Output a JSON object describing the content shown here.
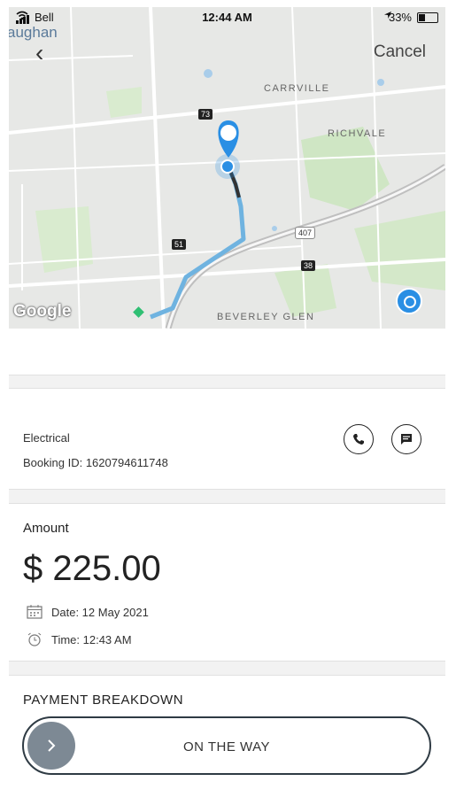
{
  "status_bar": {
    "carrier": "Bell",
    "time": "12:44 AM",
    "battery": "33%"
  },
  "map": {
    "region_label": "aughan",
    "cancel_label": "Cancel",
    "labels": {
      "carrville": "CARRVILLE",
      "richvale": "RICHVALE",
      "beverley_glen": "BEVERLEY GLEN"
    },
    "shields": {
      "r73": "73",
      "r51": "51",
      "r407": "407",
      "r38": "38"
    },
    "attribution": "Google"
  },
  "booking": {
    "service": "Electrical",
    "booking_id": "Booking ID: 1620794611748"
  },
  "payment": {
    "amount_label": "Amount",
    "amount": "$ 225.00",
    "date": "Date: 12 May 2021",
    "time": "Time: 12:43 AM"
  },
  "breakdown_title": "PAYMENT BREAKDOWN",
  "slider": {
    "label": "ON THE WAY"
  },
  "colors": {
    "route": "#6fb3e0",
    "accent": "#2a8fe4",
    "knob": "#7d8994",
    "slider_border": "#2f3b44"
  }
}
